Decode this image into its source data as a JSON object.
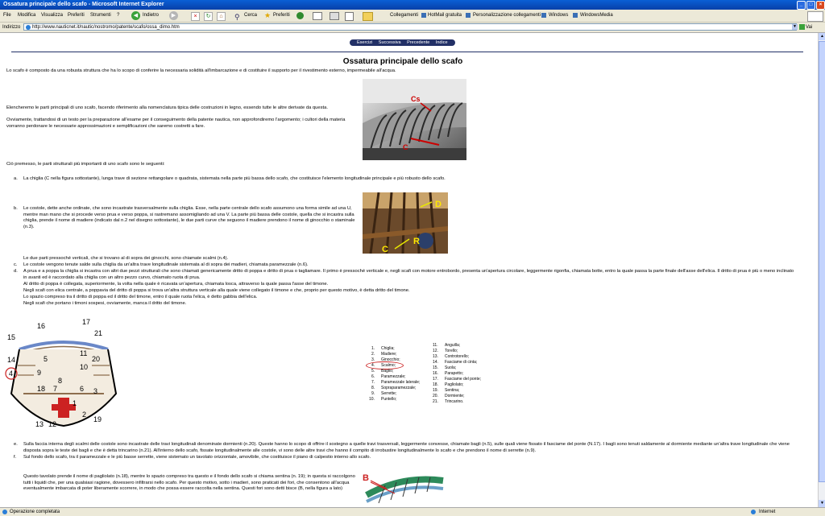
{
  "window": {
    "title": "Ossatura principale dello scafo - Microsoft Internet Explorer"
  },
  "menu": [
    "File",
    "Modifica",
    "Visualizza",
    "Preferiti",
    "Strumenti",
    "?"
  ],
  "toolbar": {
    "back": "Indietro",
    "search": "Cerca",
    "favorites": "Preferiti",
    "links": [
      "Collegamenti",
      "HotMail gratuita",
      "Personalizzazione collegamenti",
      "Windows",
      "WindowsMedia"
    ]
  },
  "address": {
    "label": "Indirizzo",
    "url": "http://www.nauticnet.it/nautic/nostromo/patente/scafo/ossa_dimo.htm",
    "go": "Vai"
  },
  "nav": [
    "Esercizi",
    "Successiva",
    "Precedente",
    "Indice"
  ],
  "page": {
    "title": "Ossatura principale dello scafo",
    "intro": "Lo scafo è composto da una robusta struttura che ha lo scopo di conferire la necessaria solidità all'imbarcazione e di costituire il supporto per il rivestimento esterno, impermeabile all'acqua.",
    "para2": "Elencheremo le parti principali di uno scafo, facendo riferimento alla nomenclatura tipica delle costruzioni in legno, essendo tutte le altre derivate da questa.",
    "para3": "Ovviamente, trattandosi di un testo per la preparazione all'esame per il conseguimento della patente nautica, non approfondiremo l'argomento; i cultori della materia vorranno perdonare le necessarie approssimazioni e semplificazioni che saremo costretti a fare.",
    "para4": "Ciò premesso, le parti strutturali più importanti di uno scafo sono le seguenti:",
    "item_a_letter": "a.",
    "item_a": "La chiglia (C nella figura sottostante), lunga trave di sezione rettangolare o quadrata, sistemata nella parte più bassa dello scafo, che costituisce l'elemento longitudinale principale e più robusto dello scafo.",
    "item_b_letter": "b.",
    "item_b": "Le costole, dette anche ordinate, che sono incastrate trasversalmente sulla chiglia. Esse, nella parte centrale dello scafo assumono una forma simile ad una U, mentre man mano che si procede verso prua e verso poppa, si rastremano assomigliando ad una V. La parte più bassa delle costole, quella che si incastra sulla chiglia, prende il nome di madiere (indicato dal n.2 nel disegno sottostante), le due parti curve che seguono il madiere prendono il nome di ginocchio o staminale (n.3).",
    "item_b2": "Le due parti pressoché verticali, che si trovano al di sopra dei ginocchi, sono chiamate scalmi (n.4).",
    "item_c_letter": "c.",
    "item_c": "Le costole vengono tenute salde sulla chiglia da un'altra trave longitudinale sistemata al di sopra dei madieri, chiamata paramezzale (n.6).",
    "item_d_letter": "d.",
    "item_d": "A prua e a poppa la chiglia si incastra con altri due pezzi strutturali che sono chiamati genericamente dritto di poppa e dritto di prua o tagliamare. Il primo è pressoché verticale e, negli scafi con motore entrobordo, presenta un'apertura circolare, leggermente rigonfia, chiamata botte, entro la quale passa la parte finale dell'asse dell'elica. Il dritto di prua è più o meno inclinato in avanti ed è raccordato alla chiglia con un altro pezzo curvo, chiamato ruota di prua.",
    "item_d2": "Al dritto di poppa è collegata, superiormente, la volta nella quale è ricavata un'apertura, chiamata losca, attraverso la quale passa l'asse del timone.",
    "item_d3": "Negli scafi con elica centrale, a poppavia del dritto di poppa si trova un'altra struttura verticale alla quale viene collegato il timone e che, proprio per questo motivo, è detta dritto del timone.",
    "item_d4": "Lo spazio compreso tra il dritto di poppa ed il dritto del timone, entro il quale ruota l'elica, è detto gabbia dell'elica.",
    "item_d5": "Negli scafi che portano i timoni sospesi, ovviamente, manca il dritto del timone.",
    "item_e_letter": "e.",
    "item_e": "Sulla faccia interna degli scalmi delle costole sono incastrate delle travi longitudinali denominate dormienti (n.20). Queste hanno lo scopo di offrire il sostegno a quelle travi trasversali, leggermente convesse, chiamate bagli (n.5), sulle quali viene fissato il fasciame del ponte (N.17). I bagli sono tenuti saldamente al dormiente mediante un'altra trave longitudinale che viene disposta sopra le teste dei bagli e che è detta trincarino (n.21). All'interno dello scafo, fissate longitudinalmente alle costole, vi sono delle altre travi che hanno il compito di irrobustire longitudinalmente lo scafo e che prendono il nome di serrette (n.9).",
    "item_f_letter": "f.",
    "item_f": "Sul fondo dello scafo, tra il paramezzale e le più basse serrette, viene sistemato un tavolato orizzontale, amovibile, che costituisce il piano di calpestio interno allo scafo.",
    "item_g": "Questo tavolato prende il nome di pagliolato (n.18), mentre lo spazio compreso tra questo e il fondo dello scafo si chiama sentina (n. 19); in questa si raccolgono tutti i liquidi che, per una qualsiasi ragione, dovessero infiltrarsi nello scafo. Per questo motivo, sotto i madieri, sono praticati dei fori, che consentono all'acqua eventualmente imbarcata di poter liberamente scorrere, in modo che possa essere raccolta nella sentina. Questi fori sono detti bisce (B, nella figura a lato)"
  },
  "figure_labels": {
    "cs": "Cs",
    "c": "C",
    "d": "D",
    "r": "R",
    "b": "B",
    "numbers": [
      "17",
      "16",
      "21",
      "15",
      "14",
      "11",
      "5",
      "20",
      "10",
      "9",
      "4",
      "8",
      "7",
      "18",
      "6",
      "3",
      "1",
      "2",
      "13",
      "12",
      "19"
    ]
  },
  "legend_left": [
    "1.",
    "Chiglia;",
    "2.",
    "Madiere;",
    "3.",
    "Ginocchio;",
    "4.",
    "Scalmo;",
    "5.",
    "Baglio;",
    "6.",
    "Paramezzale;",
    "7.",
    "Paramezzale laterale;",
    "8.",
    "Sopraparamezzale;",
    "9.",
    "Serrette;",
    "10.",
    "Puntello;"
  ],
  "legend_right": [
    "11.",
    "Anguilla;",
    "12.",
    "Torello;",
    "13.",
    "Controtorello;",
    "14.",
    "Fasciame di cinta;",
    "15.",
    "Suola;",
    "16.",
    "Parapetto;",
    "17.",
    "Fasciame del ponte;",
    "18.",
    "Pagliolato;",
    "19.",
    "Sentina;",
    "20.",
    "Dormiente;",
    "21.",
    "Trincarino."
  ],
  "status": {
    "left": "Operazione completata",
    "zone": "Internet"
  }
}
